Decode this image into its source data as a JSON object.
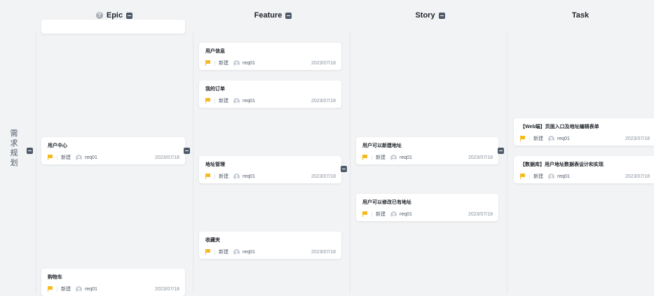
{
  "columns": {
    "epic": {
      "title": "Epic",
      "help": "?"
    },
    "feature": {
      "title": "Feature"
    },
    "story": {
      "title": "Story"
    },
    "task": {
      "title": "Task"
    }
  },
  "row": {
    "label": "需\n求\n规\n划"
  },
  "cards": {
    "epic_user_center": {
      "title": "用户中心",
      "status": "新建",
      "user": "req01",
      "date": "2023/07/18"
    },
    "epic_cart": {
      "title": "购物车",
      "status": "新建",
      "user": "req01",
      "date": "2023/07/18"
    },
    "feat_user_info": {
      "title": "用户信息",
      "status": "新建",
      "user": "req01",
      "date": "2023/07/18"
    },
    "feat_my_orders": {
      "title": "我的订单",
      "status": "新建",
      "user": "req01",
      "date": "2023/07/18"
    },
    "feat_address": {
      "title": "地址管理",
      "status": "新建",
      "user": "req01",
      "date": "2023/07/18"
    },
    "feat_favorites": {
      "title": "收藏夹",
      "status": "新建",
      "user": "req01",
      "date": "2023/07/18"
    },
    "story_new_address": {
      "title": "用户可以新建地址",
      "status": "新建",
      "user": "req01",
      "date": "2023/07/18"
    },
    "story_edit_address": {
      "title": "用户可以修改已有地址",
      "status": "新建",
      "user": "req01",
      "date": "2023/07/18"
    },
    "task_web": {
      "title": "【Web端】页面入口及地址编辑表单",
      "status": "新建",
      "user": "req01",
      "date": "2023/07/18"
    },
    "task_db": {
      "title": "【数据库】用户地址数据表设计和实现",
      "status": "新建",
      "user": "req01",
      "date": "2023/07/18"
    }
  }
}
